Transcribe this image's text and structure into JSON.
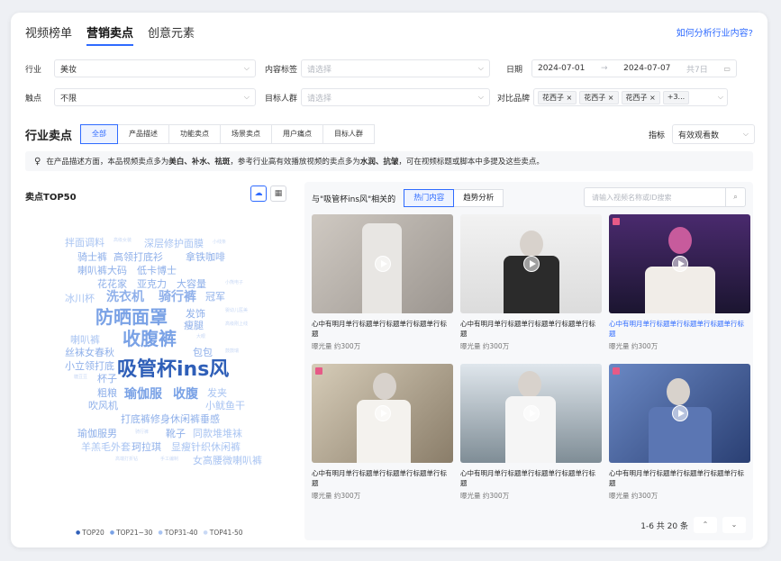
{
  "tabs": [
    "视频榜单",
    "营销卖点",
    "创意元素"
  ],
  "active_tab": 1,
  "help_link": "如何分析行业内容?",
  "filters": {
    "industry_label": "行业",
    "industry_value": "美妆",
    "content_tag_label": "内容标签",
    "content_tag_placeholder": "请选择",
    "date_label": "日期",
    "date_start": "2024-07-01",
    "date_sep": "→",
    "date_end": "2024-07-07",
    "date_span": "共7日",
    "touchpoint_label": "触点",
    "touchpoint_value": "不限",
    "target_label": "目标人群",
    "target_placeholder": "请选择",
    "brand_label": "对比品牌",
    "brand_chips": [
      "花西子 ×",
      "花西子 ×",
      "花西子 ×",
      "+3..."
    ]
  },
  "selling_points": {
    "title": "行业卖点",
    "pills": [
      "全部",
      "产品描述",
      "功能卖点",
      "场景卖点",
      "用户痛点",
      "目标人群"
    ],
    "metric_label": "指标",
    "metric_value": "有效观看数"
  },
  "notice": {
    "prefix": "在产品描述方面，本品视频卖点多为",
    "bold1": "美白、补水、祛斑",
    "middle": "，参考行业高有效播放视频的卖点多为",
    "bold2": "水润、抗皱",
    "suffix": "，可在视频标题或脚本中多提及这些卖点。"
  },
  "cloud": {
    "title": "卖点TOP50",
    "words": [
      {
        "t": "拌面调料",
        "c": "#a9c4f2",
        "s": 11
      },
      {
        "t": "高级女装",
        "c": "#c9d9f5",
        "s": 5
      },
      {
        "t": "深层修护面膜",
        "c": "#a9c4f2",
        "s": 11
      },
      {
        "t": "小线条",
        "c": "#c9d9f5",
        "s": 5
      },
      {
        "t": "骑士裤",
        "c": "#8fb0ea",
        "s": 11
      },
      {
        "t": "高领打底衫",
        "c": "#8fb0ea",
        "s": 11
      },
      {
        "t": "拿铁咖啡",
        "c": "#8fb0ea",
        "s": 11
      },
      {
        "t": "喇叭裤大码",
        "c": "#8fb0ea",
        "s": 11
      },
      {
        "t": "低卡博士",
        "c": "#8fb0ea",
        "s": 11
      },
      {
        "t": "花花家",
        "c": "#8fb0ea",
        "s": 11
      },
      {
        "t": "亚克力",
        "c": "#8fb0ea",
        "s": 11
      },
      {
        "t": "大容量",
        "c": "#8fb0ea",
        "s": 11
      },
      {
        "t": "小熊电子",
        "c": "#c9d9f5",
        "s": 5
      },
      {
        "t": "冰川杯",
        "c": "#a9c4f2",
        "s": 11
      },
      {
        "t": "洗衣机",
        "c": "#8fb0ea",
        "s": 14
      },
      {
        "t": "骑行裤",
        "c": "#8fb0ea",
        "s": 14
      },
      {
        "t": "冠军",
        "c": "#8fb0ea",
        "s": 11
      },
      {
        "t": "防晒面罩",
        "c": "#7aa2e6",
        "s": 20
      },
      {
        "t": "发饰",
        "c": "#8fb0ea",
        "s": 11
      },
      {
        "t": "婴幼儿医美",
        "c": "#c9d9f5",
        "s": 5
      },
      {
        "t": "瘦腿",
        "c": "#8fb0ea",
        "s": 11
      },
      {
        "t": "高级刚上线",
        "c": "#c9d9f5",
        "s": 5
      },
      {
        "t": "喇叭裤",
        "c": "#a9c4f2",
        "s": 11
      },
      {
        "t": "收腹裤",
        "c": "#7aa2e6",
        "s": 20
      },
      {
        "t": "大眼",
        "c": "#c9d9f5",
        "s": 5
      },
      {
        "t": "丝袜女春秋",
        "c": "#8fb0ea",
        "s": 11
      },
      {
        "t": "包包",
        "c": "#8fb0ea",
        "s": 11
      },
      {
        "t": "鼓鼓瑞",
        "c": "#c9d9f5",
        "s": 5
      },
      {
        "t": "小立领打底",
        "c": "#8fb0ea",
        "s": 11
      },
      {
        "t": "吸管杯ins风",
        "c": "#2f5fb8",
        "s": 22
      },
      {
        "t": "糖豆豆",
        "c": "#c9d9f5",
        "s": 5
      },
      {
        "t": "杯子",
        "c": "#8fb0ea",
        "s": 11
      },
      {
        "t": "粗粮",
        "c": "#8fb0ea",
        "s": 11
      },
      {
        "t": "瑜伽服",
        "c": "#7aa2e6",
        "s": 14
      },
      {
        "t": "收腹",
        "c": "#7aa2e6",
        "s": 14
      },
      {
        "t": "发夹",
        "c": "#a9c4f2",
        "s": 11
      },
      {
        "t": "吹风机",
        "c": "#8fb0ea",
        "s": 11
      },
      {
        "t": "小鱿鱼干",
        "c": "#a9c4f2",
        "s": 11
      },
      {
        "t": "打底裤修身休闲裤垂感",
        "c": "#8fb0ea",
        "s": 11
      },
      {
        "t": "瑜伽服男",
        "c": "#8fb0ea",
        "s": 11
      },
      {
        "t": "骑行裤",
        "c": "#c9d9f5",
        "s": 5
      },
      {
        "t": "靴子",
        "c": "#8fb0ea",
        "s": 11
      },
      {
        "t": "同款堆堆袜",
        "c": "#a9c4f2",
        "s": 11
      },
      {
        "t": "羊羔毛外套",
        "c": "#a9c4f2",
        "s": 11
      },
      {
        "t": "珂拉琪",
        "c": "#8fb0ea",
        "s": 11
      },
      {
        "t": "显瘦针织休闲裤",
        "c": "#a9c4f2",
        "s": 11
      },
      {
        "t": "高端打折钻",
        "c": "#c9d9f5",
        "s": 5
      },
      {
        "t": "手工编制",
        "c": "#c9d9f5",
        "s": 5
      },
      {
        "t": "女高腰微喇叭裤",
        "c": "#a9c4f2",
        "s": 11
      }
    ],
    "legend": [
      "TOP20",
      "TOP21~30",
      "TOP31-40",
      "TOP41-50"
    ],
    "legend_colors": [
      "#2f5fb8",
      "#7aa2e6",
      "#a9c4f2",
      "#c9d9f5"
    ]
  },
  "related": {
    "prefix": "与\"吸管杯ins风\"相关的",
    "tabs": [
      "热门内容",
      "趋势分析"
    ],
    "search_placeholder": "请输入视频名称或ID搜索",
    "videos": [
      {
        "title": "心中有明月单行标题单行标题单行标题单行标题",
        "exposure": "曝光量 约300万",
        "link": false
      },
      {
        "title": "心中有明月单行标题单行标题单行标题单行标题",
        "exposure": "曝光量 约300万",
        "link": false
      },
      {
        "title": "心中有明月单行标题单行标题单行标题单行标题",
        "exposure": "曝光量 约300万",
        "link": true
      },
      {
        "title": "心中有明月单行标题单行标题单行标题单行标题",
        "exposure": "曝光量 约300万",
        "link": false
      },
      {
        "title": "心中有明月单行标题单行标题单行标题单行标题",
        "exposure": "曝光量 约300万",
        "link": false
      },
      {
        "title": "心中有明月单行标题单行标题单行标题单行标题",
        "exposure": "曝光量 约300万",
        "link": false
      }
    ],
    "pager_text": "1-6 共 20 条"
  },
  "colors": {
    "accent": "#2f6bff"
  }
}
